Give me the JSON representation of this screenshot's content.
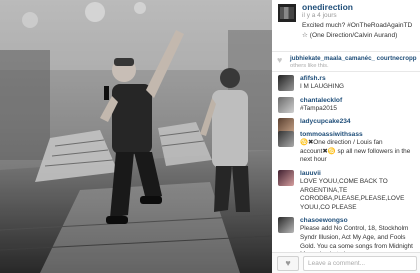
{
  "post": {
    "username": "onedirection",
    "time_ago": "il y a 4 jours",
    "caption": "Excited much? #OnTheRoadAgainTD ☆ (One Direction/Calvin Aurand)"
  },
  "likes": {
    "likers": "jubhiekate_maala_camanéc_ courtnecropp",
    "sub": "others like this."
  },
  "comments": [
    {
      "user": "afifsh.rs",
      "text": "I M LAUGHING"
    },
    {
      "user": "chantalecklof",
      "text": "#Tampa2015"
    },
    {
      "user": "ladycupcake234",
      "text": ""
    },
    {
      "user": "tommoassiwithsass",
      "text": "♋✖One direction / Louis fan account✖♋ sp all new followers in the next hour"
    },
    {
      "user": "lauuvii",
      "text": "LOVE YOUU,COME BACK TO ARGENTINA,TE CORODBA,PLEASE,PLEASE,LOVE YOUU,CO PLEASE"
    },
    {
      "user": "chasoewongso",
      "text": "Please add No Control, 18, Stockholm Syndr Illusion, Act My Age, and Fools Gold. You ca some songs from Midnight Memories but pl"
    }
  ],
  "comment_box": {
    "placeholder": "Leave a comment..."
  },
  "icons": {
    "like": "heart-icon",
    "avatar": "avatar"
  }
}
